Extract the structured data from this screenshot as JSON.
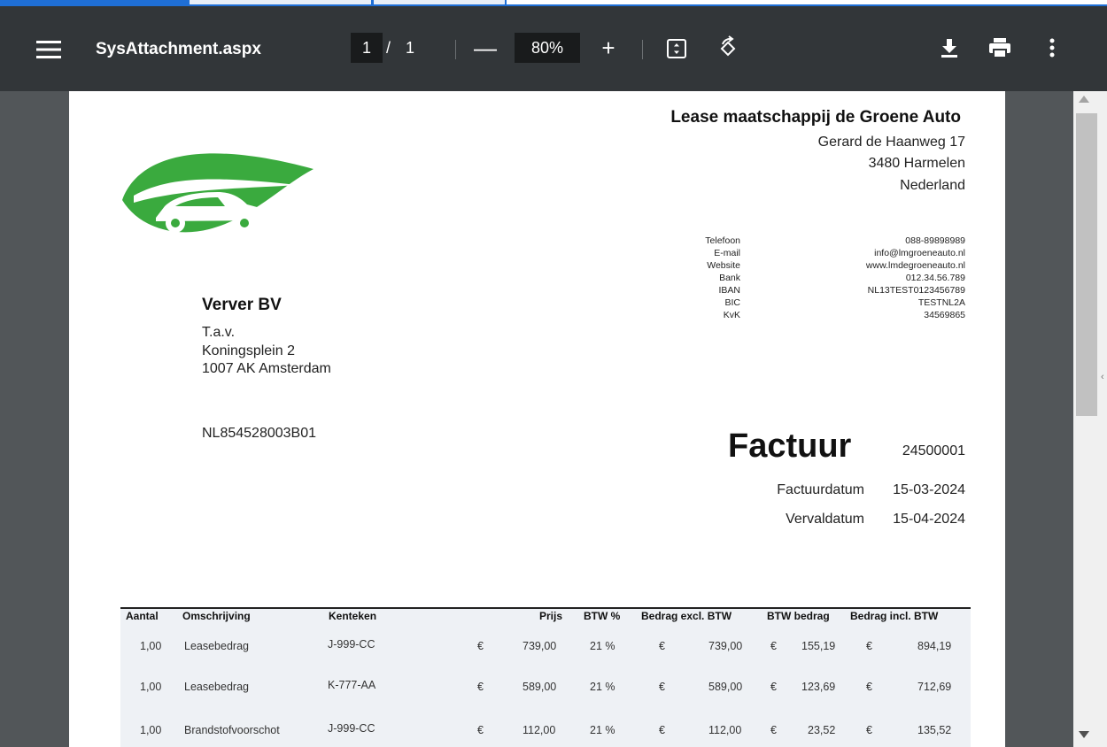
{
  "toolbar": {
    "title": "SysAttachment.aspx",
    "current_page": "1",
    "page_separator": "/",
    "total_pages": "1",
    "zoom": "80%",
    "zoom_out_label": "—",
    "zoom_in_label": "+"
  },
  "invoice": {
    "company": {
      "name": "Lease maatschappij de Groene Auto",
      "street": "Gerard de Haanweg 17",
      "city": "3480  Harmelen",
      "country": "Nederland"
    },
    "contact": [
      {
        "label": "Telefoon",
        "value": "088-89898989"
      },
      {
        "label": "E-mail",
        "value": "info@lmgroeneauto.nl"
      },
      {
        "label": "Website",
        "value": "www.lmdegroeneauto.nl"
      },
      {
        "label": "Bank",
        "value": "012.34.56.789"
      },
      {
        "label": "IBAN",
        "value": "NL13TEST0123456789"
      },
      {
        "label": "BIC",
        "value": "TESTNL2A"
      },
      {
        "label": "KvK",
        "value": "34569865"
      }
    ],
    "customer": {
      "name": "Verver BV",
      "attn": "T.a.v.",
      "street": "Koningsplein 2",
      "city": "1007 AK  Amsterdam",
      "vat_number": "NL854528003B01"
    },
    "title": "Factuur",
    "number": "24500001",
    "invoice_date_label": "Factuurdatum",
    "invoice_date": "15-03-2024",
    "due_date_label": "Vervaldatum",
    "due_date": "15-04-2024",
    "columns": [
      "Aantal",
      "Omschrijving",
      "Kenteken",
      "Prijs",
      "BTW %",
      "Bedrag excl. BTW",
      "BTW bedrag",
      "Bedrag incl. BTW"
    ],
    "currency": "€",
    "lines": [
      {
        "qty": "1,00",
        "desc": "Leasebedrag",
        "plate": "J-999-CC",
        "price": "739,00",
        "vat_pct": "21 %",
        "excl": "739,00",
        "vat": "155,19",
        "incl": "894,19"
      },
      {
        "qty": "1,00",
        "desc": "Leasebedrag",
        "plate": "K-777-AA",
        "price": "589,00",
        "vat_pct": "21 %",
        "excl": "589,00",
        "vat": "123,69",
        "incl": "712,69"
      },
      {
        "qty": "1,00",
        "desc": "Brandstofvoorschot",
        "plate": "J-999-CC",
        "price": "112,00",
        "vat_pct": "21 %",
        "excl": "112,00",
        "vat": "23,52",
        "incl": "135,52"
      }
    ]
  },
  "colors": {
    "toolbar_bg": "#323639",
    "viewer_bg": "#525659",
    "logo_green": "#3aaa3e",
    "table_bg": "#eef1f5"
  }
}
